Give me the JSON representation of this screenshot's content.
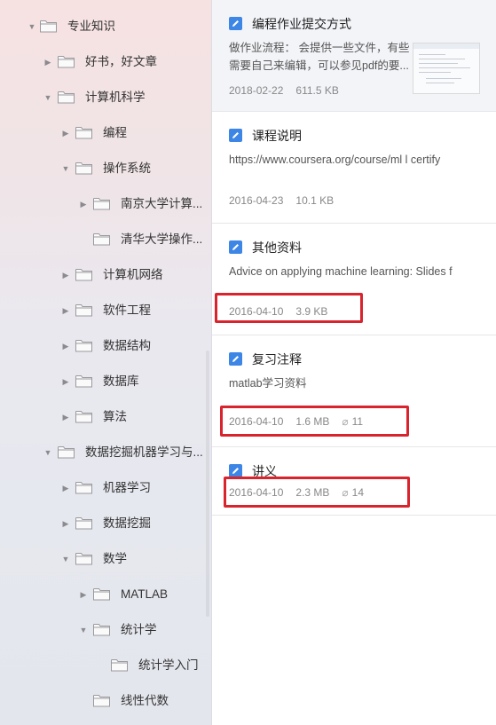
{
  "sidebar": {
    "items": [
      {
        "label": "专业知识",
        "expanded": true
      },
      {
        "label": "好书，好文章",
        "expanded": false
      },
      {
        "label": "计算机科学",
        "expanded": true
      },
      {
        "label": "编程",
        "expanded": false
      },
      {
        "label": "操作系统",
        "expanded": true
      },
      {
        "label": "南京大学计算...",
        "expanded": false
      },
      {
        "label": "清华大学操作...",
        "expanded": false
      },
      {
        "label": "计算机网络",
        "expanded": false
      },
      {
        "label": "软件工程",
        "expanded": false
      },
      {
        "label": "数据结构",
        "expanded": false
      },
      {
        "label": "数据库",
        "expanded": false
      },
      {
        "label": "算法",
        "expanded": false
      },
      {
        "label": "数据挖掘机器学习与...",
        "expanded": true
      },
      {
        "label": "机器学习",
        "expanded": false
      },
      {
        "label": "数据挖掘",
        "expanded": false
      },
      {
        "label": "数学",
        "expanded": true
      },
      {
        "label": "MATLAB",
        "expanded": false
      },
      {
        "label": "统计学",
        "expanded": true
      },
      {
        "label": "统计学入门",
        "expanded": false
      },
      {
        "label": "线性代数",
        "expanded": false
      }
    ]
  },
  "notes": [
    {
      "title": "编程作业提交方式",
      "snippet": "做作业流程： 会提供一些文件，有些需要自己来编辑，可以参见pdf的要...",
      "date": "2018-02-22",
      "size": "611.5 KB",
      "attachments": ""
    },
    {
      "title": "课程说明",
      "snippet": "https://www.coursera.org/course/ml l certify",
      "date": "2016-04-23",
      "size": "10.1 KB",
      "attachments": ""
    },
    {
      "title": "其他资料",
      "snippet": "Advice on applying machine learning: Slides f",
      "date": "2016-04-10",
      "size": "3.9 KB",
      "attachments": ""
    },
    {
      "title": "复习注释",
      "snippet": "matlab学习资料",
      "date": "2016-04-10",
      "size": "1.6 MB",
      "attachments": "11"
    },
    {
      "title": "讲义",
      "snippet": "",
      "date": "2016-04-10",
      "size": "2.3 MB",
      "attachments": "14"
    }
  ],
  "icons": {
    "folder": "folder-icon",
    "note": "note-edit-icon",
    "attachment": "paperclip-icon",
    "expand": "chevron-right-icon",
    "collapse": "chevron-down-icon"
  },
  "colors": {
    "accent": "#3d86e6",
    "highlight": "#d9232d"
  }
}
